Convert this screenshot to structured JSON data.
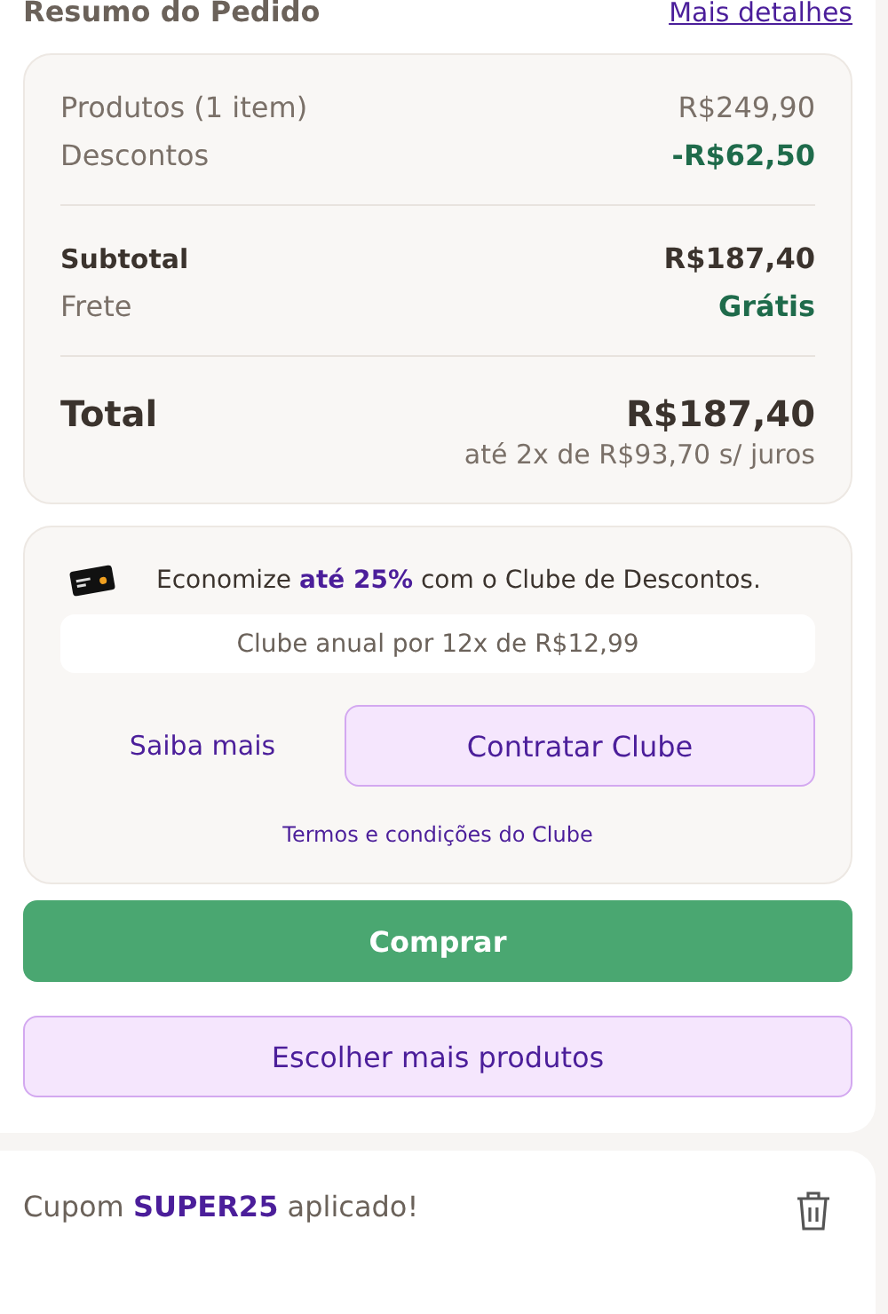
{
  "header": {
    "title": "Resumo do Pedido",
    "link": "Mais detalhes"
  },
  "summary": {
    "groups": [
      [
        {
          "label": "Produtos (1 item)",
          "value": "R$249,90",
          "kind": "regular",
          "positive": false
        },
        {
          "label": "Descontos",
          "value": "-R$62,50",
          "kind": "regular",
          "positive": true
        }
      ],
      [
        {
          "label": "Subtotal",
          "value": "R$187,40",
          "kind": "strong",
          "positive": false
        },
        {
          "label": "Frete",
          "value": "Grátis",
          "kind": "regular",
          "positive": true
        }
      ],
      [
        {
          "label": "Total",
          "value": "R$187,40",
          "kind": "total",
          "positive": false
        }
      ]
    ],
    "installments": "até 2x de R$93,70 s/ juros"
  },
  "club": {
    "message": "Economize **até 25%** com o Clube de Descontos.",
    "offer": "Clube anual por 12x de R$12,99",
    "learn_more": "Saiba mais",
    "subscribe": "Contratar Clube",
    "terms": "Termos e condições do Clube"
  },
  "buttons": {
    "buy": "Comprar",
    "more": "Escolher mais produtos"
  },
  "coupon": {
    "text": "Cupom **SUPER25** aplicado!"
  }
}
